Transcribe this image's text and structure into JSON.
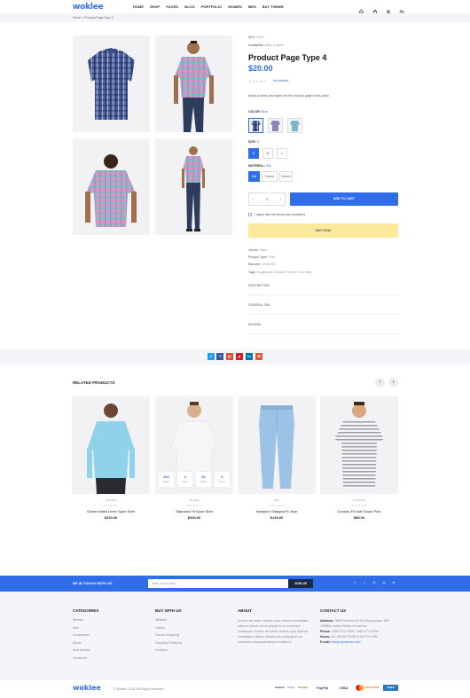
{
  "header": {
    "logo": "woklee",
    "nav": [
      "HOME",
      "SHOP",
      "PAGES",
      "BLOG",
      "PORTFOLIO",
      "WOMEN",
      "MEN",
      "BUY THEME!"
    ]
  },
  "breadcrumb": {
    "home": "Home",
    "sep": ">",
    "current": "Product Page Type 4"
  },
  "product": {
    "sku_label": "SKU:",
    "sku": "2346",
    "availability_label": "Availability:",
    "availability": "Many in stock",
    "title": "Product Page Type 4",
    "price": "$20.00",
    "stars": "★★★★★",
    "reviews": "No reviews",
    "short_description": "Small product description for the product page in this place",
    "color_label": "COLOR:",
    "color_value": "Blue",
    "size_label": "SIZE:",
    "size_value": "S",
    "sizes": [
      "S",
      "M",
      "L"
    ],
    "material_label": "MATERIAL:",
    "material_value": "Silk",
    "materials": [
      "Silk",
      "Cotton",
      "Denim"
    ],
    "qty_minus": "−",
    "qty": "1",
    "qty_plus": "+",
    "add_to_cart": "ADD TO CART",
    "agree": "I agree with the terms and conditions",
    "buy_now": "BUY NOW",
    "vendor_label": "Vendor:",
    "vendor": "Woro",
    "type_label": "Product Type:",
    "type": "Shirt",
    "barcode_label": "Barcode:",
    "barcode": "33456789",
    "tags_label": "Tags:",
    "tags": "Sunglasses, Women, Shorts, Cool, New"
  },
  "accordion": [
    "DESCRIPTION",
    "GENERAL TAB",
    "REVIEW"
  ],
  "share": [
    {
      "icon": "twitter-icon",
      "glyph": "t",
      "color": "#1da1f2"
    },
    {
      "icon": "facebook-icon",
      "glyph": "f",
      "color": "#3b5998"
    },
    {
      "icon": "google-plus-icon",
      "glyph": "g+",
      "color": "#dd4b39"
    },
    {
      "icon": "pinterest-icon",
      "glyph": "p",
      "color": "#cb2027"
    },
    {
      "icon": "linkedin-icon",
      "glyph": "in",
      "color": "#0077b5"
    },
    {
      "icon": "email-icon",
      "glyph": "✉",
      "color": "#e0583f"
    }
  ],
  "related": {
    "title": "RELATED PRODUCTS",
    "prev": "‹",
    "next": "›",
    "items": [
      {
        "vendor": "WOKEE",
        "name": "Ocean Wash Linen Sport Shirt",
        "price": "$220.00",
        "stars": "★★★★★"
      },
      {
        "vendor": "WOKEE",
        "name": "Standard Fit Sport Shirt",
        "price": "$340.00",
        "stars": "★★★★★"
      },
      {
        "vendor": "HNP",
        "name": "Hampton Straight-Fit Jean",
        "price": "$140.00",
        "stars": "★★★★★"
      },
      {
        "vendor": "LACOSTE",
        "name": "Custom-Fit Soft-Touch Polo",
        "price": "$80.00",
        "stars": "★★★★★"
      }
    ],
    "countdown": [
      {
        "value": "252",
        "unit": "Days"
      },
      {
        "value": "4",
        "unit": "Hrs"
      },
      {
        "value": "30",
        "unit": "Mins"
      },
      {
        "value": "6",
        "unit": "Secs"
      }
    ]
  },
  "newsletter": {
    "title": "BE IN TOUCH WITH US:",
    "placeholder": "Enter your e-mail",
    "button": "JOIN US",
    "social": [
      "f",
      "t",
      "G",
      "◎",
      "●"
    ]
  },
  "footer": {
    "categories": {
      "title": "CATEGORIES",
      "items": [
        "Women",
        "Men",
        "Accessories",
        "Shoes",
        "New Arrivals",
        "Clearence"
      ]
    },
    "buy": {
      "title": "BUY WITH US",
      "items": [
        "Affiliates",
        "Gallery",
        "Secure Shopping",
        "Shipping & Returns",
        "Contacts"
      ]
    },
    "about": {
      "title": "ABOUT",
      "text": "Ut enim ad minim veniam, quis nostrud exercitation ullamco laboris nisi ut aliquip ex ea commodo consequat. Ut enim ad minim veniam, quis nostrud exercitation ullamco laboris nisi ut aliquip ex ea commodo consequat tempor incididunt."
    },
    "contact": {
      "title": "CONTACT US",
      "address_label": "Address:",
      "address": "7895 Piermont Dr NE Albuquerque, NM 198866, United States of America",
      "phone_label": "Phone:",
      "phone": "+566 4774 9930; +566 4774 9940",
      "hours_label": "Hours:",
      "hours": "ALL WEEK FROM 9 AM TO 9 PM",
      "email_label": "E-mail:",
      "email": "info@mydomain.com"
    },
    "logo": "woklee",
    "copyright": "© Woklee 2018. All Rights Reserved",
    "payments": [
      "amazon",
      "stripe",
      "Shopify",
      "PayPal",
      "VISA",
      "DISCOVER",
      "AMEX"
    ]
  }
}
